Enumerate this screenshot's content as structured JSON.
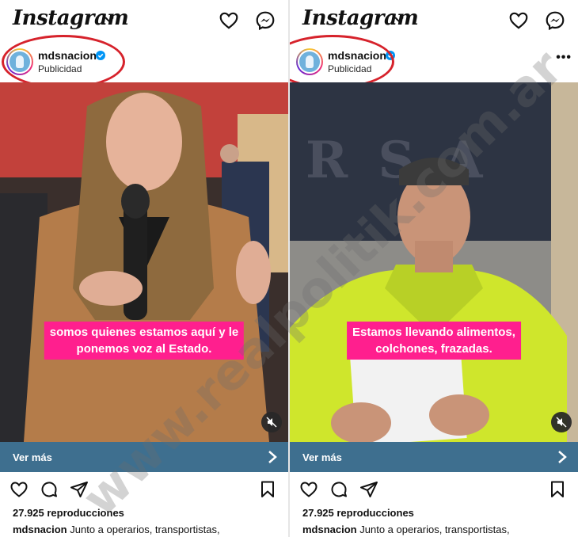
{
  "posts": [
    {
      "app_logo": "Instagram",
      "account": {
        "username": "mdsnacion",
        "verified": true,
        "sponsored_label": "Publicidad"
      },
      "caption_overlay": [
        "somos quienes estamos aquí y le",
        "ponemos voz al Estado."
      ],
      "cta_label": "Ver más",
      "views": "27.925 reproducciones",
      "caption_user": "mdsnacion",
      "caption_text": "Junto a operarios, transportistas,"
    },
    {
      "app_logo": "Instagram",
      "account": {
        "username": "mdsnacion",
        "verified": true,
        "sponsored_label": "Publicidad"
      },
      "caption_overlay": [
        "Estamos llevando alimentos,",
        "colchones, frazadas."
      ],
      "cta_label": "Ver más",
      "views": "27.925 reproducciones",
      "caption_user": "mdsnacion",
      "caption_text": "Junto a operarios, transportistas,"
    }
  ],
  "watermark": "www.realpolitik.com.ar",
  "colors": {
    "caption_bg": "#ff1f8e",
    "cta_bg": "#3e6f8f",
    "verified_blue": "#0095f6",
    "highlight_ring": "#d6222b"
  },
  "icons": [
    "chevron-down-icon",
    "heart-icon",
    "messenger-icon",
    "verified-badge-icon",
    "more-icon",
    "mute-icon",
    "chevron-right-icon",
    "comment-icon",
    "share-icon",
    "bookmark-icon"
  ]
}
